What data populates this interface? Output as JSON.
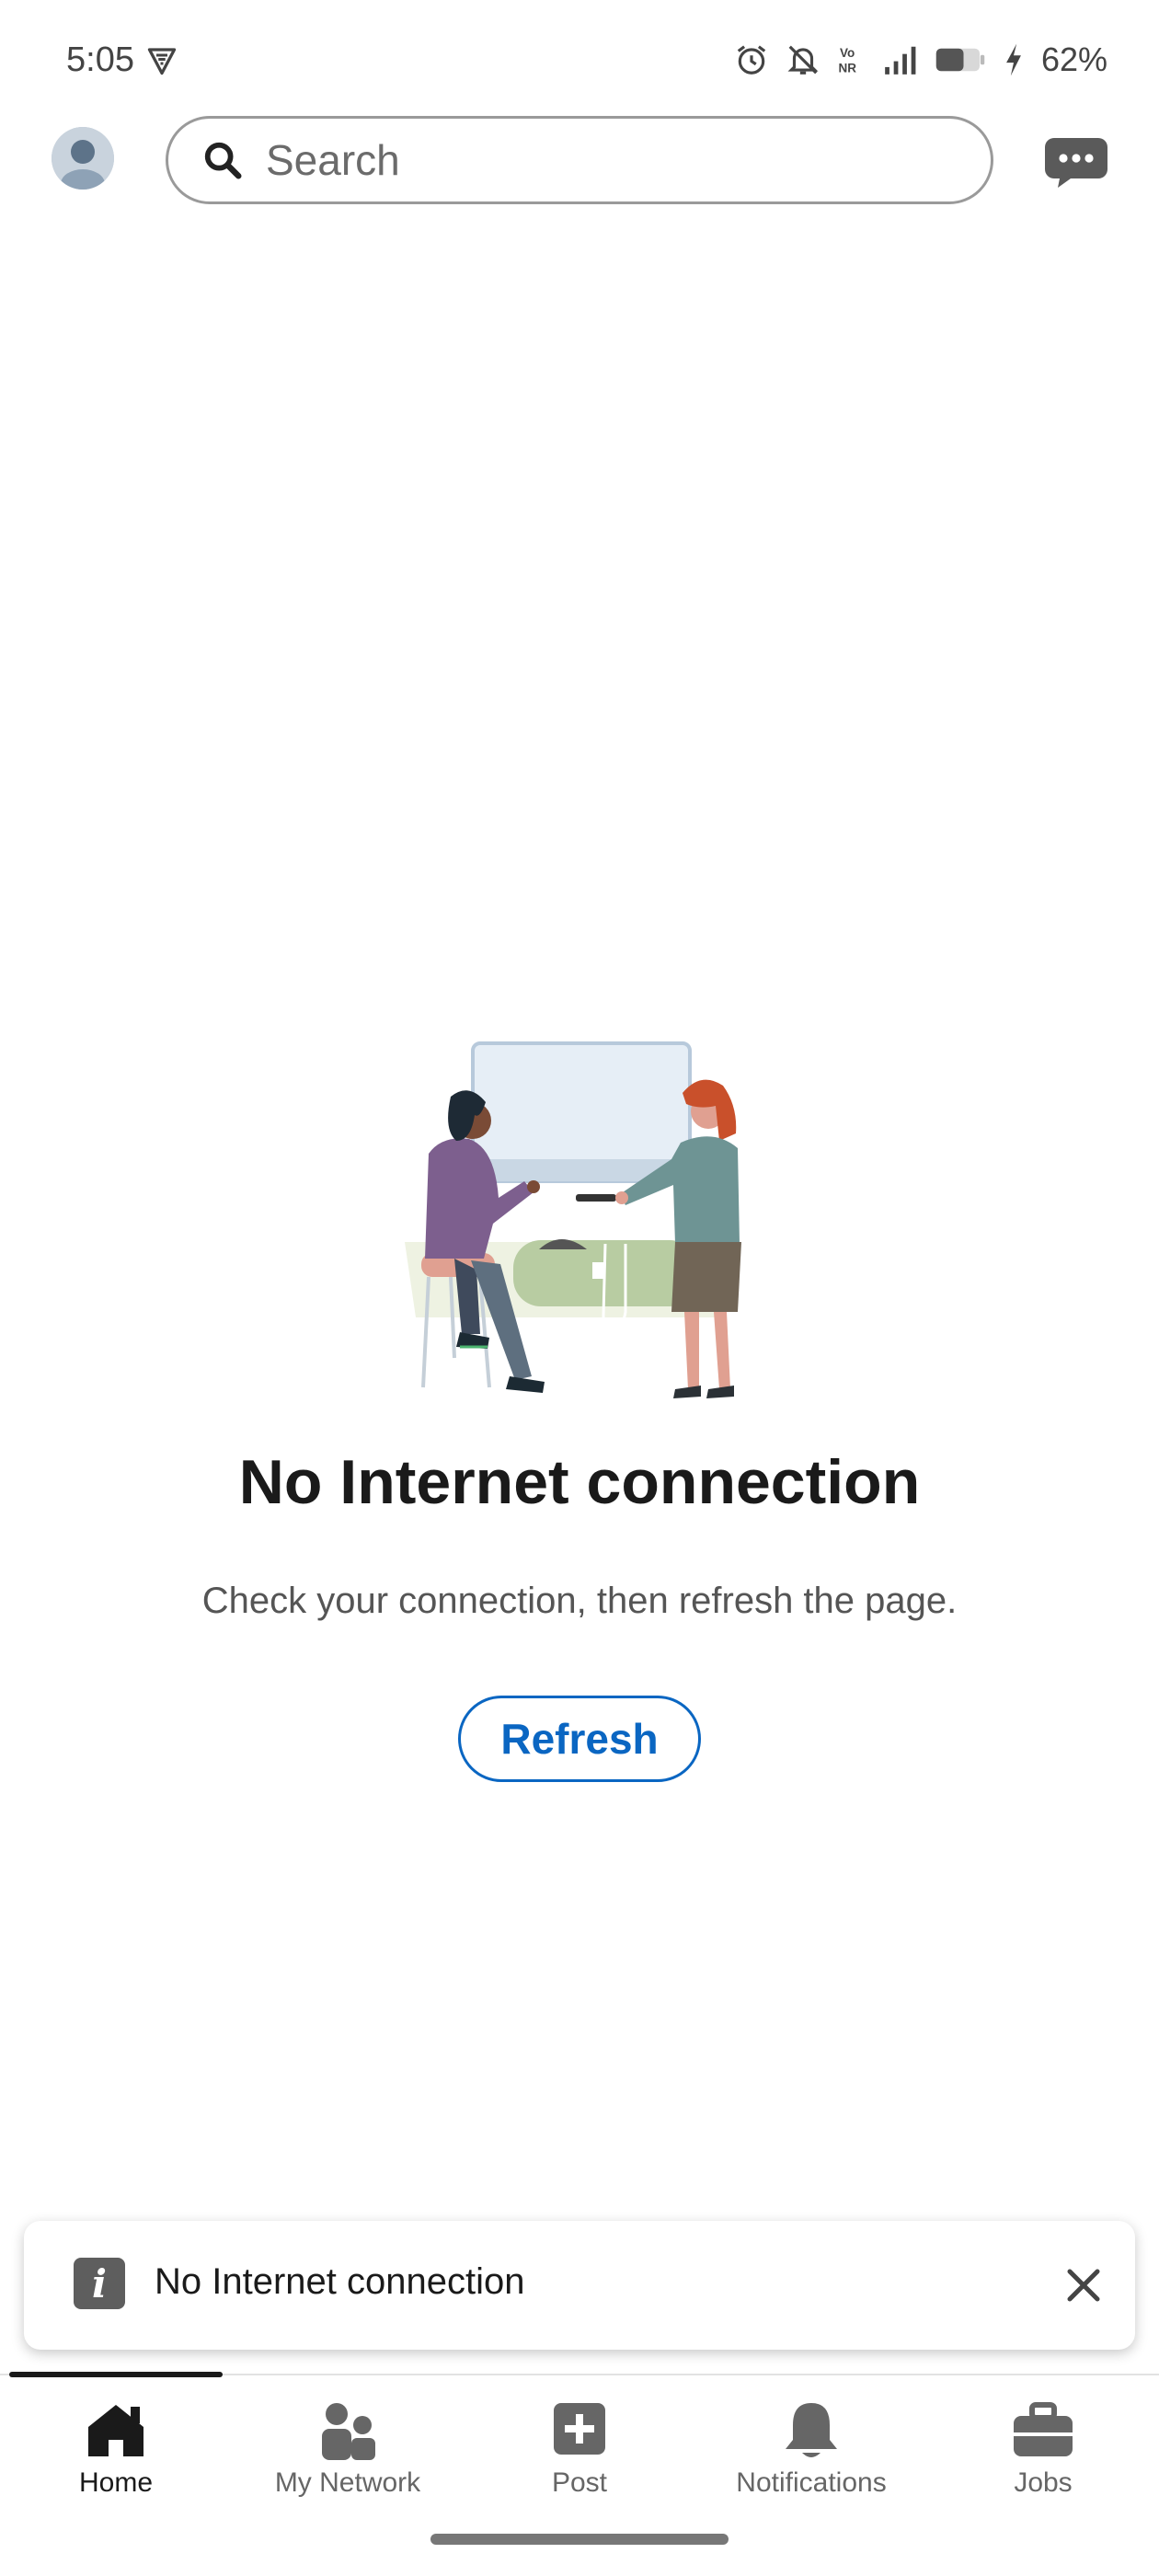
{
  "status_bar": {
    "time": "5:05",
    "battery_percent": "62%",
    "icons": [
      "vpn-icon",
      "alarm-icon",
      "mute-icon",
      "vonr-icon",
      "signal-icon",
      "battery-icon",
      "charging-icon"
    ]
  },
  "header": {
    "search_placeholder": "Search",
    "icons": [
      "avatar",
      "search-icon",
      "messaging-icon"
    ]
  },
  "empty_state": {
    "title": "No Internet connection",
    "subtitle": "Check your connection, then refresh the page.",
    "refresh_label": "Refresh"
  },
  "toast": {
    "message": "No Internet connection",
    "icons": [
      "info-icon",
      "close-icon"
    ]
  },
  "bottom_nav": {
    "items": [
      {
        "label": "Home",
        "icon": "home-icon",
        "active": true
      },
      {
        "label": "My Network",
        "icon": "my-network-icon",
        "active": false
      },
      {
        "label": "Post",
        "icon": "post-icon",
        "active": false
      },
      {
        "label": "Notifications",
        "icon": "bell-icon",
        "active": false
      },
      {
        "label": "Jobs",
        "icon": "briefcase-icon",
        "active": false
      }
    ]
  },
  "colors": {
    "brand_blue": "#0a66c2",
    "text_primary": "#1a1a1a",
    "text_secondary": "#555555"
  }
}
